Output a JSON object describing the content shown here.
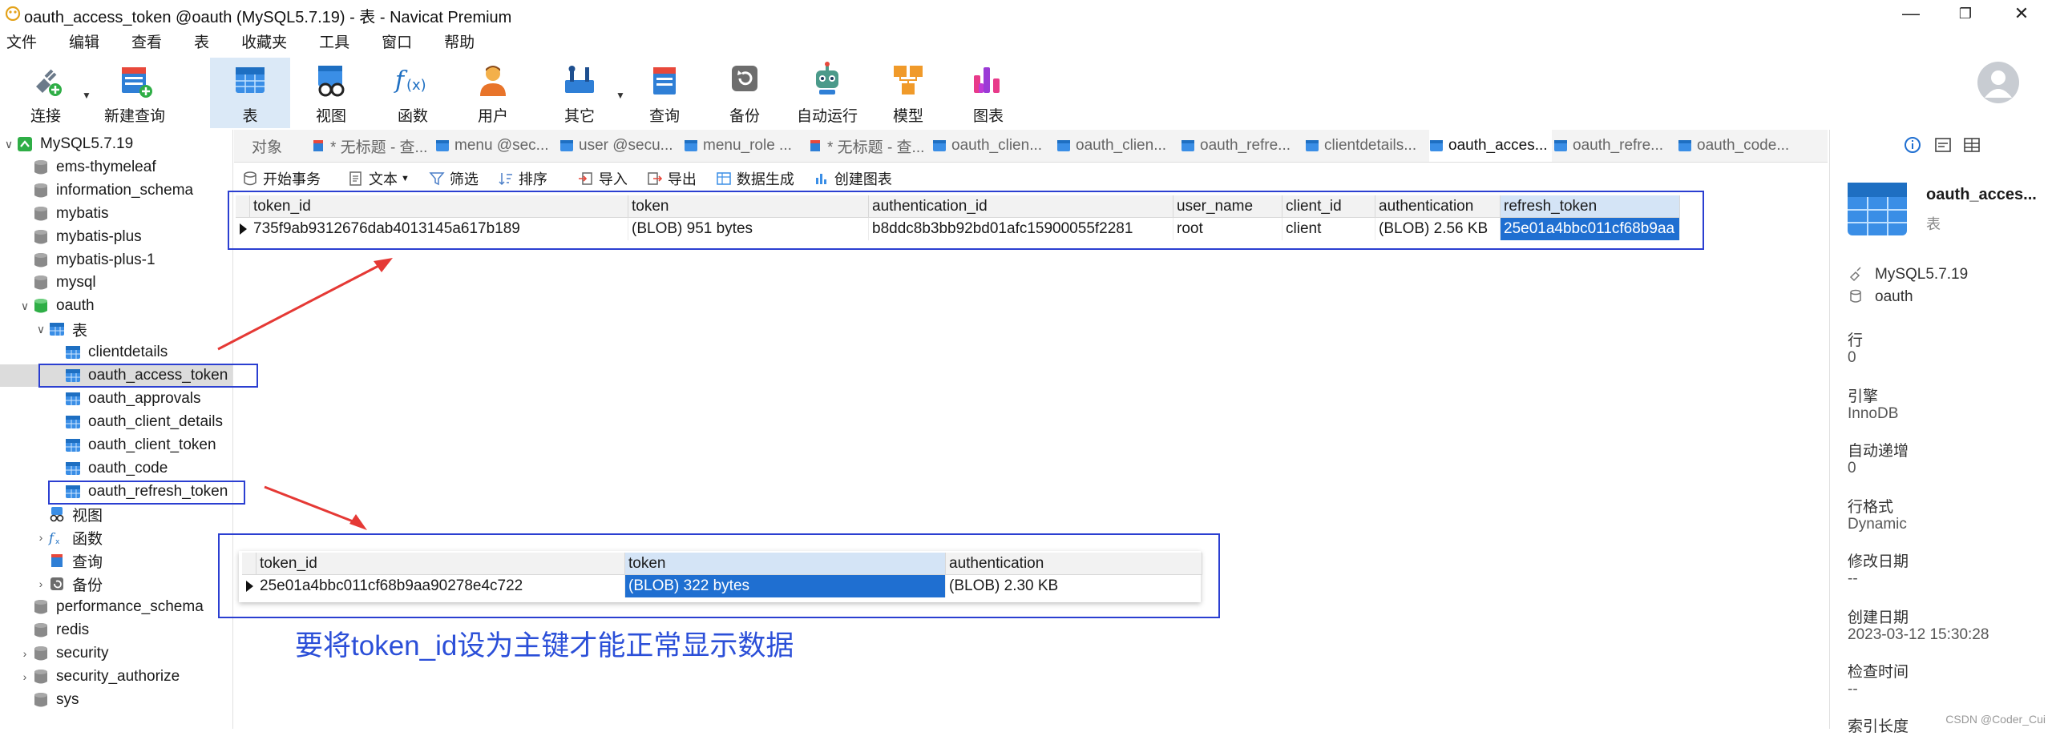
{
  "window": {
    "title": "oauth_access_token @oauth (MySQL5.7.19) - 表 - Navicat Premium",
    "minimize_glyph": "—",
    "maximize_glyph": "❐",
    "close_glyph": "✕"
  },
  "menu": [
    "文件",
    "编辑",
    "查看",
    "表",
    "收藏夹",
    "工具",
    "窗口",
    "帮助"
  ],
  "toolbar": {
    "connect": "连接",
    "new_query": "新建查询",
    "table": "表",
    "view": "视图",
    "function": "函数",
    "user": "用户",
    "other": "其它",
    "query": "查询",
    "backup": "备份",
    "automation": "自动运行",
    "model": "模型",
    "chart": "图表"
  },
  "tree": {
    "connection": "MySQL5.7.19",
    "databases": [
      "ems-thymeleaf",
      "information_schema",
      "mybatis",
      "mybatis-plus",
      "mybatis-plus-1",
      "mysql"
    ],
    "open_db": "oauth",
    "tables_group": "表",
    "tables": [
      "clientdetails",
      "oauth_access_token",
      "oauth_approvals",
      "oauth_client_details",
      "oauth_client_token",
      "oauth_code",
      "oauth_refresh_token"
    ],
    "groups": [
      "视图",
      "函数",
      "查询",
      "备份"
    ],
    "databases_after": [
      "performance_schema",
      "redis",
      "security",
      "security_authorize",
      "sys"
    ]
  },
  "tabs": {
    "objects": "对象",
    "items": [
      "* 无标题 - 查...",
      "menu @sec...",
      "user @secu...",
      "menu_role ...",
      "* 无标题 - 查...",
      "oauth_clien...",
      "oauth_clien...",
      "oauth_refre...",
      "clientdetails...",
      "oauth_acces...",
      "oauth_refre...",
      "oauth_code..."
    ]
  },
  "subtoolbar": {
    "begin_tx": "开始事务",
    "text": "文本",
    "filter": "筛选",
    "sort": "排序",
    "import": "导入",
    "export": "导出",
    "generate": "数据生成",
    "create_chart": "创建图表"
  },
  "grid1": {
    "columns": [
      "token_id",
      "token",
      "authentication_id",
      "user_name",
      "client_id",
      "authentication",
      "refresh_token"
    ],
    "row": [
      "735f9ab9312676dab4013145a617b189",
      "(BLOB) 951 bytes",
      "b8ddc8b3bb92bd01afc15900055f2281",
      "root",
      "client",
      "(BLOB) 2.56 KB",
      "25e01a4bbc011cf68b9aa"
    ]
  },
  "grid2": {
    "columns": [
      "token_id",
      "token",
      "authentication"
    ],
    "row": [
      "25e01a4bbc011cf68b9aa90278e4c722",
      "(BLOB) 322 bytes",
      "(BLOB) 2.30 KB"
    ]
  },
  "caption": "要将token_id设为主键才能正常显示数据",
  "info": {
    "name": "oauth_acces...",
    "type": "表",
    "connection": "MySQL5.7.19",
    "database": "oauth",
    "rows_label": "行",
    "rows_value": "0",
    "engine_label": "引擎",
    "engine_value": "InnoDB",
    "autoinc_label": "自动递增",
    "autoinc_value": "0",
    "rowformat_label": "行格式",
    "rowformat_value": "Dynamic",
    "modified_label": "修改日期",
    "modified_value": "--",
    "created_label": "创建日期",
    "created_value": "2023-03-12 15:30:28",
    "checktime_label": "检查时间",
    "checktime_value": "--",
    "index_label": "索引长度"
  },
  "watermark": "CSDN @Coder_Cui",
  "colors": {
    "accent": "#1f6fd1",
    "annotation": "#2b3fd1",
    "arrow": "#e53935"
  }
}
